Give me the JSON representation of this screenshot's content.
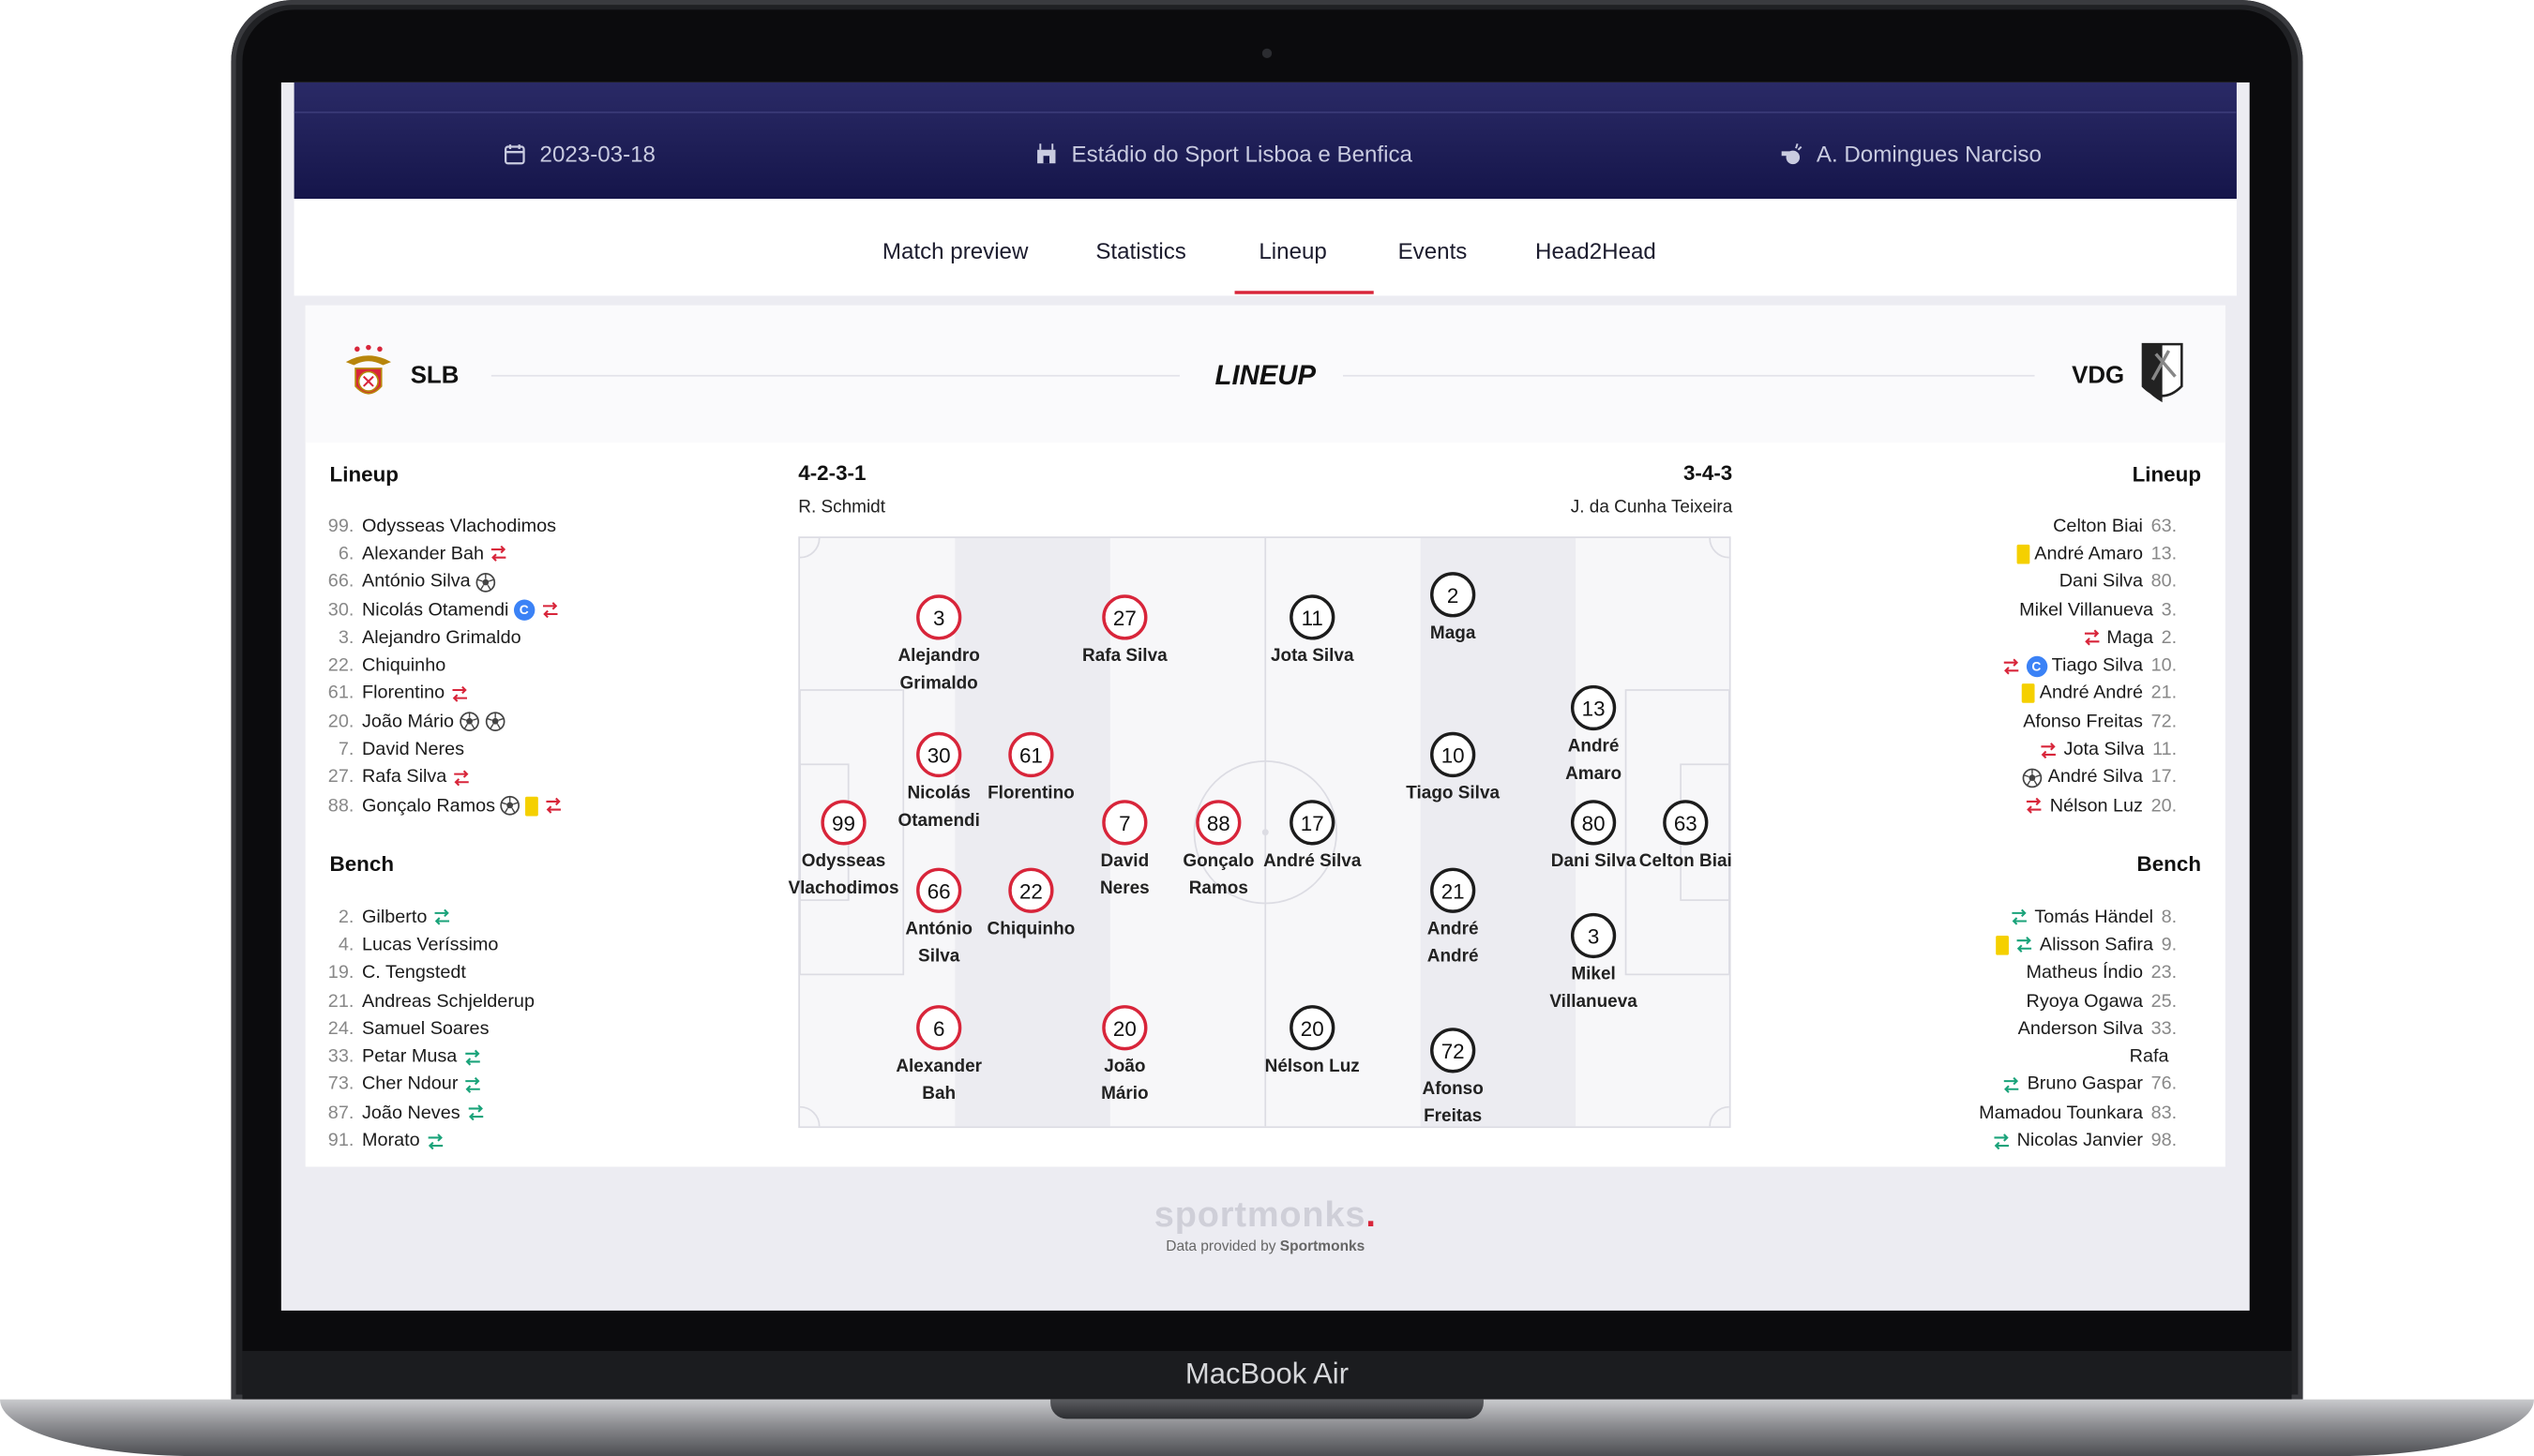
{
  "device": {
    "label": "MacBook Air"
  },
  "match": {
    "date": "2023-03-18",
    "venue": "Estádio do Sport Lisboa e Benfica",
    "referee": "A. Domingues Narciso"
  },
  "tabs": [
    "Match preview",
    "Statistics",
    "Lineup",
    "Events",
    "Head2Head"
  ],
  "active_tab": "Lineup",
  "lineup_title": "LINEUP",
  "home": {
    "code": "SLB",
    "lineup_heading": "Lineup",
    "bench_heading": "Bench",
    "formation": "4-2-3-1",
    "coach": "R. Schmidt",
    "color": "#d8253a",
    "starters": [
      {
        "num": "99.",
        "name": "Odysseas Vlachodimos",
        "icons": []
      },
      {
        "num": "6.",
        "name": "Alexander Bah",
        "icons": [
          "sub-out"
        ]
      },
      {
        "num": "66.",
        "name": "António Silva",
        "icons": [
          "goal"
        ]
      },
      {
        "num": "30.",
        "name": "Nicolás Otamendi",
        "icons": [
          "captain",
          "sub-out"
        ]
      },
      {
        "num": "3.",
        "name": "Alejandro Grimaldo",
        "icons": []
      },
      {
        "num": "22.",
        "name": "Chiquinho",
        "icons": []
      },
      {
        "num": "61.",
        "name": "Florentino",
        "icons": [
          "sub-out"
        ]
      },
      {
        "num": "20.",
        "name": "João Mário",
        "icons": [
          "goal",
          "goal"
        ]
      },
      {
        "num": "7.",
        "name": "David Neres",
        "icons": []
      },
      {
        "num": "27.",
        "name": "Rafa Silva",
        "icons": [
          "sub-out"
        ]
      },
      {
        "num": "88.",
        "name": "Gonçalo Ramos",
        "icons": [
          "goal",
          "yellow",
          "sub-out"
        ]
      }
    ],
    "bench": [
      {
        "num": "2.",
        "name": "Gilberto",
        "icons": [
          "sub-in"
        ]
      },
      {
        "num": "4.",
        "name": "Lucas Veríssimo",
        "icons": []
      },
      {
        "num": "19.",
        "name": "C. Tengstedt",
        "icons": []
      },
      {
        "num": "21.",
        "name": "Andreas Schjelderup",
        "icons": []
      },
      {
        "num": "24.",
        "name": "Samuel Soares",
        "icons": []
      },
      {
        "num": "33.",
        "name": "Petar Musa",
        "icons": [
          "sub-in"
        ]
      },
      {
        "num": "73.",
        "name": "Cher Ndour",
        "icons": [
          "sub-in"
        ]
      },
      {
        "num": "87.",
        "name": "João Neves",
        "icons": [
          "sub-in"
        ]
      },
      {
        "num": "91.",
        "name": "Morato",
        "icons": [
          "sub-in"
        ]
      }
    ]
  },
  "away": {
    "code": "VDG",
    "lineup_heading": "Lineup",
    "bench_heading": "Bench",
    "formation": "3-4-3",
    "coach": "J. da Cunha Teixeira",
    "color": "#1c1c1c",
    "starters": [
      {
        "num": "63.",
        "name": "Celton Biai",
        "icons": []
      },
      {
        "num": "13.",
        "name": "André Amaro",
        "icons": [
          "yellow"
        ]
      },
      {
        "num": "80.",
        "name": "Dani Silva",
        "icons": []
      },
      {
        "num": "3.",
        "name": "Mikel Villanueva",
        "icons": []
      },
      {
        "num": "2.",
        "name": "Maga",
        "icons": [
          "sub-out"
        ]
      },
      {
        "num": "10.",
        "name": "Tiago Silva",
        "icons": [
          "sub-out",
          "captain"
        ]
      },
      {
        "num": "21.",
        "name": "André André",
        "icons": [
          "yellow"
        ]
      },
      {
        "num": "72.",
        "name": "Afonso Freitas",
        "icons": []
      },
      {
        "num": "11.",
        "name": "Jota Silva",
        "icons": [
          "sub-out"
        ]
      },
      {
        "num": "17.",
        "name": "André Silva",
        "icons": [
          "goal"
        ]
      },
      {
        "num": "20.",
        "name": "Nélson Luz",
        "icons": [
          "sub-out"
        ]
      }
    ],
    "bench": [
      {
        "num": "8.",
        "name": "Tomás Händel",
        "icons": [
          "sub-in"
        ]
      },
      {
        "num": "9.",
        "name": "Alisson Safira",
        "icons": [
          "yellow",
          "sub-in"
        ]
      },
      {
        "num": "23.",
        "name": "Matheus Índio",
        "icons": []
      },
      {
        "num": "25.",
        "name": "Ryoya Ogawa",
        "icons": []
      },
      {
        "num": "33.",
        "name": "Anderson Silva",
        "icons": []
      },
      {
        "num": "",
        "name": "Rafa",
        "icons": []
      },
      {
        "num": "76.",
        "name": "Bruno Gaspar",
        "icons": [
          "sub-in"
        ]
      },
      {
        "num": "83.",
        "name": "Mamadou Tounkara",
        "icons": []
      },
      {
        "num": "98.",
        "name": "Nicolas Janvier",
        "icons": [
          "sub-in"
        ]
      }
    ]
  },
  "pitch": {
    "home": [
      {
        "num": "3",
        "line1": "Alejandro",
        "line2": "Grimaldo"
      },
      {
        "num": "27",
        "line1": "Rafa Silva",
        "line2": ""
      },
      {
        "num": "30",
        "line1": "Nicolás",
        "line2": "Otamendi"
      },
      {
        "num": "61",
        "line1": "Florentino",
        "line2": ""
      },
      {
        "num": "99",
        "line1": "Odysseas",
        "line2": "Vlachodimos"
      },
      {
        "num": "7",
        "line1": "David",
        "line2": "Neres"
      },
      {
        "num": "88",
        "line1": "Gonçalo",
        "line2": "Ramos"
      },
      {
        "num": "66",
        "line1": "António",
        "line2": "Silva"
      },
      {
        "num": "22",
        "line1": "Chiquinho",
        "line2": ""
      },
      {
        "num": "6",
        "line1": "Alexander",
        "line2": "Bah"
      },
      {
        "num": "20",
        "line1": "João",
        "line2": "Mário"
      }
    ],
    "away": [
      {
        "num": "11",
        "line1": "Jota Silva",
        "line2": ""
      },
      {
        "num": "2",
        "line1": "Maga",
        "line2": ""
      },
      {
        "num": "13",
        "line1": "André",
        "line2": "Amaro"
      },
      {
        "num": "10",
        "line1": "Tiago Silva",
        "line2": ""
      },
      {
        "num": "17",
        "line1": "André Silva",
        "line2": ""
      },
      {
        "num": "80",
        "line1": "Dani Silva",
        "line2": ""
      },
      {
        "num": "63",
        "line1": "Celton Biai",
        "line2": ""
      },
      {
        "num": "21",
        "line1": "André",
        "line2": "André"
      },
      {
        "num": "3",
        "line1": "Mikel",
        "line2": "Villanueva"
      },
      {
        "num": "20",
        "line1": "Nélson Luz",
        "line2": ""
      },
      {
        "num": "72",
        "line1": "Afonso",
        "line2": "Freitas"
      }
    ]
  },
  "footer": {
    "logo_text": "sportmonks",
    "logo_dot": ".",
    "credit_prefix": "Data provided by ",
    "credit_brand": "Sportmonks"
  }
}
